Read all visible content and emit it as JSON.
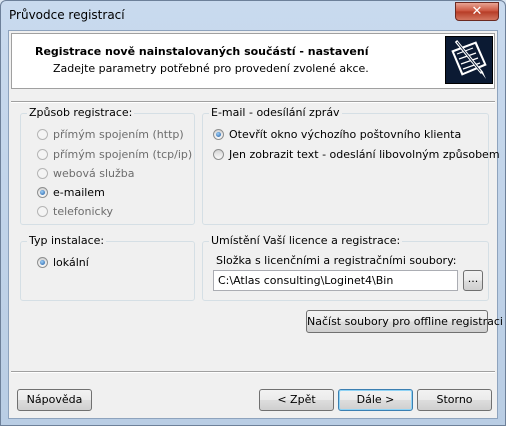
{
  "window": {
    "title": "Průvodce registrací",
    "close_glyph": "✕"
  },
  "header": {
    "title": "Registrace nově nainstalovaných součástí - nastavení",
    "subtitle": "Zadejte parametry potřebné pro provedení zvolené akce.",
    "logo_icon": "registration-form-pen-icon"
  },
  "registration_method": {
    "label": "Způsob registrace:",
    "options": [
      {
        "label": "přímým spojením (http)",
        "checked": false,
        "disabled": true
      },
      {
        "label": "přímým spojením (tcp/ip)",
        "checked": false,
        "disabled": true
      },
      {
        "label": "webová služba",
        "checked": false,
        "disabled": true
      },
      {
        "label": "e-mailem",
        "checked": true,
        "disabled": false
      },
      {
        "label": "telefonicky",
        "checked": false,
        "disabled": true
      }
    ]
  },
  "email_sending": {
    "label": "E-mail - odesílání zpráv",
    "options": [
      {
        "label": "Otevřít okno výchozího poštovního klienta",
        "checked": true
      },
      {
        "label": "Jen zobrazit text - odeslání libovolným způsobem",
        "checked": false
      }
    ]
  },
  "install_type": {
    "label": "Typ instalace:",
    "options": [
      {
        "label": "lokální",
        "checked": true
      }
    ]
  },
  "license_location": {
    "label": "Umístění Vaší licence a registrace:",
    "folder_label": "Složka s licenčními a registračními soubory:",
    "folder_value": "C:\\Atlas consulting\\Loginet4\\Bin",
    "browse_label": "...",
    "offline_button": "Načíst soubory pro offline registraci"
  },
  "footer": {
    "help": "Nápověda",
    "back": "< Zpět",
    "next": "Dále >",
    "cancel": "Storno"
  }
}
